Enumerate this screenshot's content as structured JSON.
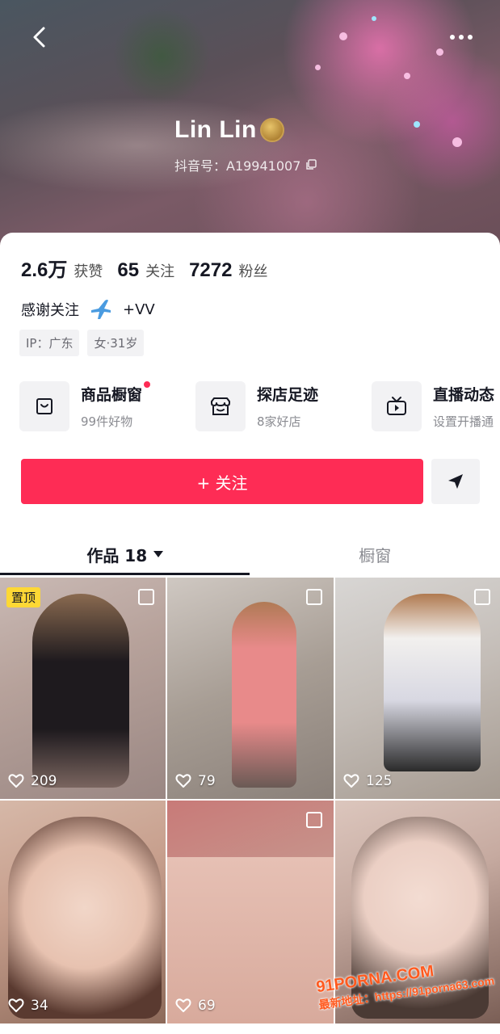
{
  "header": {
    "nickname": "Lin Lin",
    "douyin_id": "抖音号：A19941007",
    "back_icon": "chevron-left-icon",
    "more_icon": "more-dots-icon"
  },
  "stats": [
    {
      "num": "2.6万",
      "label": "获赞"
    },
    {
      "num": "65",
      "label": "关注"
    },
    {
      "num": "7272",
      "label": "粉丝"
    }
  ],
  "bio": {
    "text": "感谢关注",
    "extra": "+VV"
  },
  "tags": [
    "IP：广东",
    "女·31岁"
  ],
  "features": [
    {
      "title": "商品橱窗",
      "subtitle": "99件好物",
      "icon": "bag-icon",
      "dot": true
    },
    {
      "title": "探店足迹",
      "subtitle": "8家好店",
      "icon": "store-icon",
      "dot": false
    },
    {
      "title": "直播动态",
      "subtitle": "设置开播通",
      "icon": "tv-icon",
      "dot": false
    }
  ],
  "actions": {
    "follow_label": "+ 关注",
    "share_icon": "send-icon"
  },
  "tabs": {
    "works_label": "作品 18",
    "showcase_label": "橱窗"
  },
  "grid": [
    {
      "likes": "209",
      "pinned": "置顶",
      "multi": true
    },
    {
      "likes": "79",
      "multi": true
    },
    {
      "likes": "125",
      "multi": true
    },
    {
      "likes": "34",
      "multi": false
    },
    {
      "likes": "69",
      "multi": true
    },
    {
      "likes": "",
      "multi": false
    }
  ],
  "overlay": {
    "site_logo": "91PORNA.COM",
    "site_url": "最新地址：https://91porna63.com"
  },
  "colors": {
    "accent": "#fe2c55",
    "pin_badge": "#fdd835",
    "text_primary": "#161823",
    "text_secondary": "#8a8b91"
  }
}
